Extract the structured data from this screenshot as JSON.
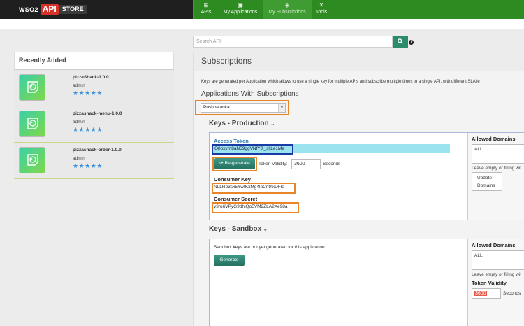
{
  "logo": {
    "part1": "WSO2",
    "part2": "API",
    "part3": "STORE"
  },
  "nav": [
    {
      "label": "APIs",
      "icon": "grid-icon"
    },
    {
      "label": "My Applications",
      "icon": "image-icon"
    },
    {
      "label": "My Subscriptions",
      "icon": "tag-icon"
    },
    {
      "label": "Tools",
      "icon": "tools-icon"
    }
  ],
  "search": {
    "placeholder": "Search API"
  },
  "recently_added": {
    "title": "Recently Added",
    "items": [
      {
        "name": "pizzaShack-1.0.0",
        "author": "admin",
        "stars": "★★★★★"
      },
      {
        "name": "pizzashack-menu-1.0.0",
        "author": "admin",
        "stars": "★★★★★"
      },
      {
        "name": "pizzashack-order-1.0.0",
        "author": "admin",
        "stars": "★★★★★"
      }
    ]
  },
  "subscriptions": {
    "title": "Subscriptions",
    "description": "Keys are generated per Application which allows to use a single key for multiple APIs and subscribe multiple times to a single API, with different SLA le",
    "apps_heading": "Applications With Subscriptions",
    "selected_app": "Pushpalanka",
    "select_arrow": "▼"
  },
  "production": {
    "heading": "Keys - Production",
    "chevron": "⌄",
    "access_token_label": "Access Token",
    "access_token": "Q8pxym8aN59ggVNfYJi_sljLe1Ma",
    "regenerate_label": "Re-generate",
    "token_validity_label": "Token Validity:",
    "token_validity": "3600",
    "seconds_label": "Seconds",
    "consumer_key_label": "Consumer Key",
    "consumer_key": "NLLRp3sx5YwfKxMg4lpCnthxDFIa",
    "consumer_secret_label": "Consumer Secret",
    "consumer_secret": "y3ru6VPyG9dhjQo5VM2ZLA2Xe98a",
    "allowed_domains_label": "Allowed Domains",
    "allowed_domains_value": "ALL",
    "domains_hint": "Leave empty or filling wit",
    "update_label_1": "Update",
    "update_label_2": "Domains"
  },
  "sandbox": {
    "heading": "Keys - Sandbox",
    "chevron": "⌄",
    "message": "Sandbox keys are not yet generated for this application.",
    "generate_label": "Generate",
    "allowed_domains_label": "Allowed Domains",
    "allowed_domains_value": "ALL",
    "domains_hint": "Leave empty or filling wit",
    "token_validity_heading": "Token Validity",
    "token_validity": "3600",
    "seconds_label": "Seconds"
  }
}
